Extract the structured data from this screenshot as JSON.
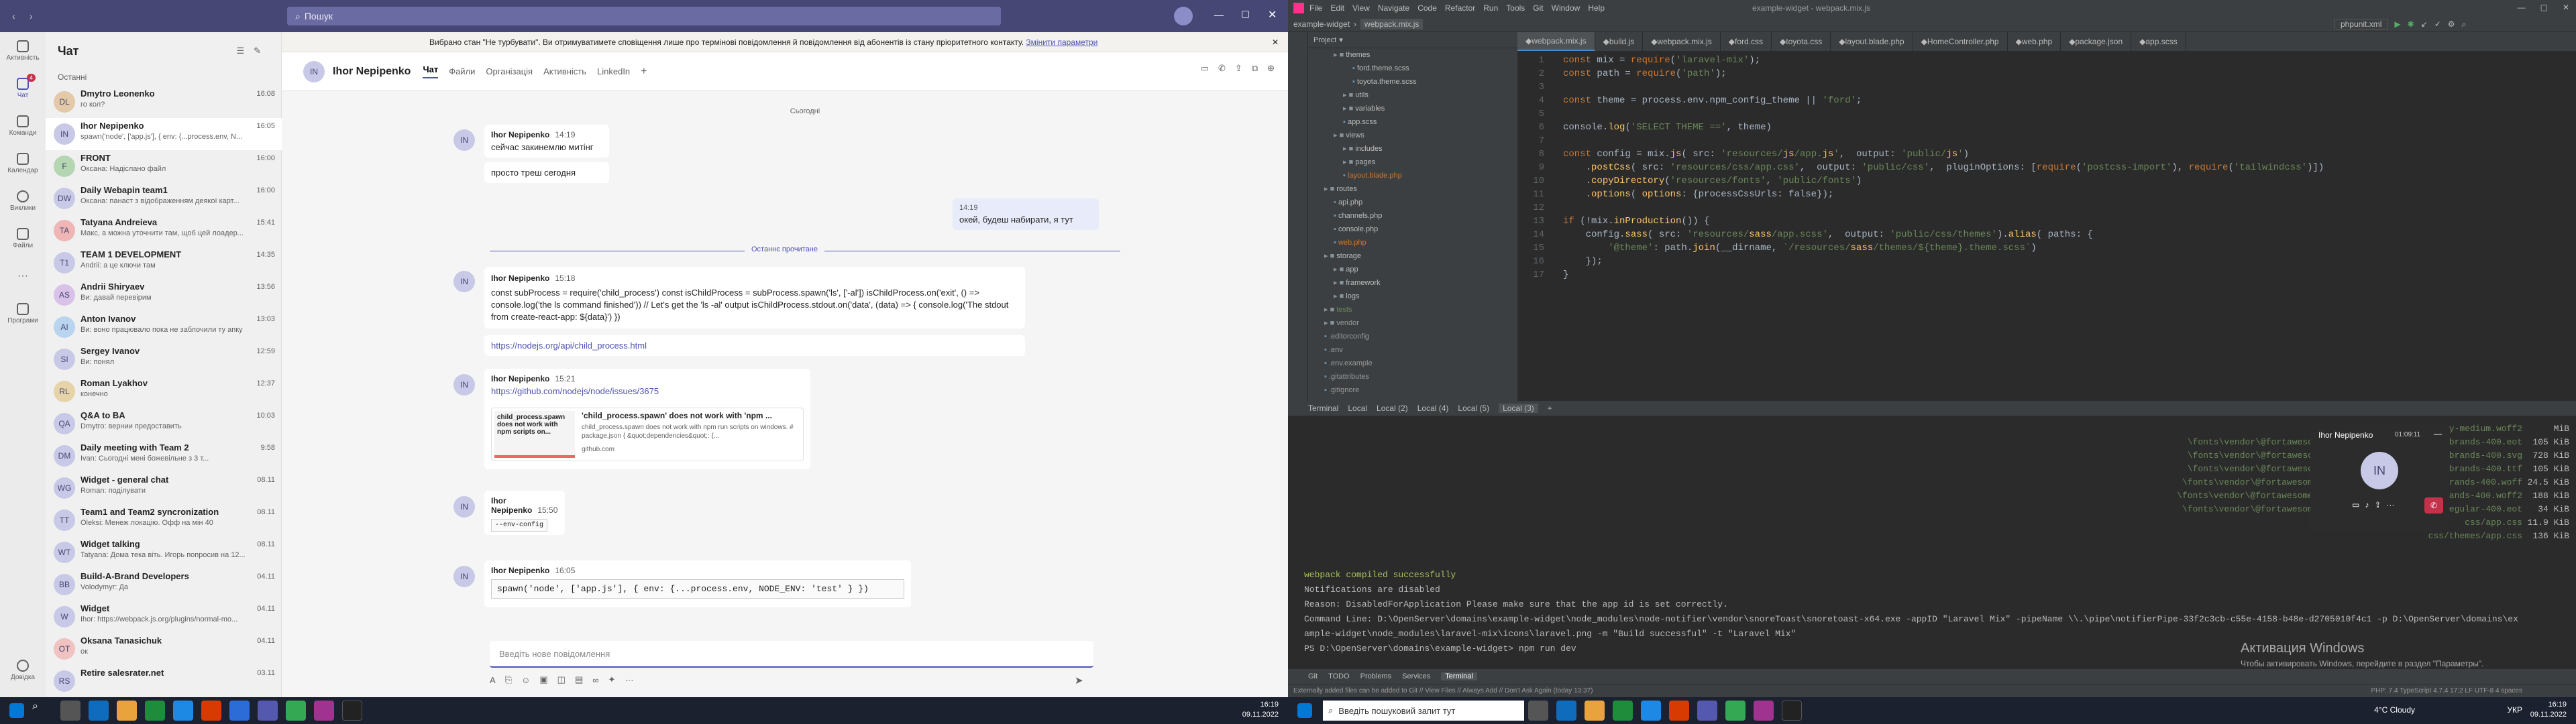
{
  "teams": {
    "search_placeholder": "Пошук",
    "rail": [
      "Активність",
      "Чат",
      "Команди",
      "Календар",
      "Виклики",
      "Файли",
      "Програми",
      "Довідка"
    ],
    "rail_badge": "4",
    "chat_header": "Чат",
    "recent_label": "Останні",
    "chats": [
      {
        "name": "Dmytro Leonenko",
        "preview": "го кол?",
        "time": "16:08",
        "initials": "DL"
      },
      {
        "name": "Ihor Nepipenko",
        "preview": "spawn('node', ['app.js'], { env: {...process.env, N...",
        "time": "16:05",
        "initials": "IN"
      },
      {
        "name": "FRONT",
        "preview": "Оксана: Надіслано файл",
        "time": "16:00",
        "initials": "F"
      },
      {
        "name": "Daily Webapin team1",
        "preview": "Оксана: панаст з відображенням деякої карт...",
        "time": "16:00",
        "initials": "DW"
      },
      {
        "name": "Tatyana Andreieva",
        "preview": "Макс, а можна уточнити там, щоб цей лоадер...",
        "time": "15:41",
        "initials": "TA"
      },
      {
        "name": "TEAM 1 DEVELOPMENT",
        "preview": "Andrii: а це ключи там",
        "time": "14:35",
        "initials": "T1"
      },
      {
        "name": "Andrii Shiryaev",
        "preview": "Ви: давай перевірим",
        "time": "13:56",
        "initials": "AS"
      },
      {
        "name": "Anton Ivanov",
        "preview": "Ви: воно працювало пока не заблочили ту апку",
        "time": "13:03",
        "initials": "AI"
      },
      {
        "name": "Sergey Ivanov",
        "preview": "Ви: понял",
        "time": "12:59",
        "initials": "SI"
      },
      {
        "name": "Roman Lyakhov",
        "preview": "конечно",
        "time": "12:37",
        "initials": "RL"
      },
      {
        "name": "Q&A to BA",
        "preview": "Dmytro: вернии предоставить",
        "time": "10:03",
        "initials": "QA"
      },
      {
        "name": "Daily meeting with Team 2",
        "preview": "Ivan: Сьогодні мені божевільне з 3 т...",
        "time": "9:58",
        "initials": "DM"
      },
      {
        "name": "Widget - general chat",
        "preview": "Roman: поділувати",
        "time": "08.11",
        "initials": "WG"
      },
      {
        "name": "Team1 and Team2 syncronization",
        "preview": "Oleksi: Менеж локацію. Офф на мін 40",
        "time": "08.11",
        "initials": "TT"
      },
      {
        "name": "Widget talking",
        "preview": "Tatyana: Дома тека віть. Игорь попросив на 12...",
        "time": "08.11",
        "initials": "WT"
      },
      {
        "name": "Build-A-Brand Developers",
        "preview": "Volodymyr: Да",
        "time": "04.11",
        "initials": "BB"
      },
      {
        "name": "Widget",
        "preview": "Ihor: https://webpack.js.org/plugins/normal-mo...",
        "time": "04.11",
        "initials": "W"
      },
      {
        "name": "Oksana Tanasichuk",
        "preview": "ок",
        "time": "04.11",
        "initials": "OT"
      },
      {
        "name": "Retire salesrater.net",
        "preview": "",
        "time": "03.11",
        "initials": "RS"
      }
    ],
    "banner": "Вибрано стан \"Не турбувати\". Ви отримуватимете сповіщення лише про термінові повідомлення й повідомлення від абонентів із стану пріоритетного контакту.",
    "banner_link": "Змінити параметри",
    "contact": {
      "name": "Ihor Nepipenko",
      "initials": "IN"
    },
    "tabs": [
      "Чат",
      "Файли",
      "Організація",
      "Активність",
      "LinkedIn",
      "+"
    ],
    "today_label": "Сьогодні",
    "read_label": "Останнє прочитане",
    "messages": {
      "m1": {
        "author": "Ihor Nepipenko",
        "time": "14:19",
        "l1": "сейчас закинемлю митінг",
        "l2": "просто треш сегодня"
      },
      "mine": {
        "time": "14:19",
        "text": "окей, будеш набирати, я тут"
      },
      "m2": {
        "author": "Ihor Nepipenko",
        "time": "15:18",
        "text": "const subProcess = require('child_process') const isChildProcess = subProcess.spawn('ls', ['-al']) isChildProcess.on('exit', () => console.log('the ls command finished')) // Let's get the 'ls -al' output isChildProcess.stdout.on('data', (data) => { console.log('The stdout from create-react-app: ${data}') })",
        "link": "https://nodejs.org/api/child_process.html"
      },
      "m3": {
        "author": "Ihor Nepipenko",
        "time": "15:21",
        "link": "https://github.com/nodejs/node/issues/3675",
        "card_title": "'child_process.spawn' does not work with 'npm ...",
        "card_text": "child_process.spawn does not work with npm run scripts on windows. # package.json { &quot;dependencies&quot;: {...",
        "card_host": "github.com",
        "thumb_title": "child_process.spawn does not work with npm scripts on..."
      },
      "m4": {
        "author": "Ihor Nepipenko",
        "time": "15:50",
        "text": "--env-config"
      },
      "m5": {
        "author": "Ihor Nepipenko",
        "time": "16:05",
        "code": "spawn('node', ['app.js'], { env: {...process.env, NODE_ENV: 'test' } })"
      }
    },
    "compose_placeholder": "Введіть нове повідомлення"
  },
  "taskbar_left": {
    "time": "16:19",
    "date": "09.11.2022",
    "search": "Введіть пошуковий запит тут"
  },
  "taskbar_right": {
    "time": "16:19",
    "date": "09.11.2022",
    "search": "Введіть пошуковий запит тут",
    "weather": "4°C Cloudy",
    "lang": "УКР"
  },
  "ide": {
    "menu": [
      "File",
      "Edit",
      "View",
      "Navigate",
      "Code",
      "Refactor",
      "Run",
      "Tools",
      "Git",
      "Window",
      "Help"
    ],
    "window_title": "example-widget - webpack.mix.js",
    "breadcrumb": "example-widget",
    "breadcrumb_file": "webpack.mix.js",
    "run_config": "phpunit.xml",
    "project_label": "Project",
    "tree": [
      "themes",
      "ford.theme.scss",
      "toyota.theme.scss",
      "utils",
      "variables",
      "app.scss",
      "views",
      "includes",
      "pages",
      "layout.blade.php",
      "routes",
      "api.php",
      "channels.php",
      "console.php",
      "web.php",
      "storage",
      "app",
      "framework",
      "logs",
      "tests",
      "vendor",
      ".editorconfig",
      ".env",
      ".env.example",
      ".gitattributes",
      ".gitignore"
    ],
    "tabs": [
      "webpack.mix.js",
      "build.js",
      "webpack.mix.js",
      "ford.css",
      "toyota.css",
      "layout.blade.php",
      "HomeController.php",
      "web.php",
      "package.json",
      "app.scss"
    ],
    "code": [
      "const mix = require('laravel-mix');",
      "const path = require('path');",
      "",
      "const theme = process.env.npm_config_theme || 'ford';",
      "",
      "console.log('SELECT THEME ==', theme)",
      "",
      "const config = mix.js( src: 'resources/js/app.js',  output: 'public/js')",
      "    .postCss( src: 'resources/css/app.css',  output: 'public/css',  pluginOptions: [require('postcss-import'), require('tailwindcss')])",
      "    .copyDirectory('resources/fonts', 'public/fonts')",
      "    .options( options: {processCssUrls: false});",
      "",
      "if (!mix.inProduction()) {",
      "    config.sass( src: 'resources/sass/app.scss',  output: 'public/css/themes').alias( paths: {",
      "        '@theme': path.join(__dirname, `/resources/sass/themes/${theme}.theme.scss`)",
      "    });",
      "}"
    ],
    "terminal_tabs": [
      "Terminal",
      "Local",
      "Local (2)",
      "Local (4)",
      "Local (5)",
      "Local (3)",
      "+"
    ],
    "terminal_top": [
      "\\fonts\\gilroy\\gilroy-medium.woff2",
      "\\fonts\\vendor\\@fortawesome\\fontawesome-free\\webfa-brands-400.eot",
      "\\fonts\\vendor\\@fortawesome\\fontawesome-free\\webfa-brands-400.svg",
      "\\fonts\\vendor\\@fortawesome\\fontawesome-free\\webfa-brands-400.ttf",
      "\\fonts\\vendor\\@fortawesome\\fontawesome-free\\webfa-brands-400.woff",
      "\\fonts\\vendor\\@fortawesome\\fontawesome-free\\webfa-brands-400.woff2",
      "\\fonts\\vendor\\@fortawesome\\fontawesome-free\\webfa-regular-400.eot",
      "css/app.css",
      "css/themes/app.css"
    ],
    "terminal_sizes": [
      "MiB",
      "105 KiB",
      "728 KiB",
      "105 KiB",
      "24.5 KiB",
      "188 KiB",
      "34 KiB",
      "11.9 KiB",
      "136 KiB"
    ],
    "terminal_lines": [
      "webpack compiled successfully",
      "Notifications are disabled",
      "Reason: DisabledForApplication Please make sure that the app id is set correctly.",
      "Command Line: D:\\OpenServer\\domains\\example-widget\\node_modules\\node-notifier\\vendor\\snoreToast\\snoretoast-x64.exe -appID \"Laravel Mix\" -pipeName \\\\.\\pipe\\notifierPipe-33f2c3cb-c55e-4158-b48e-d2705010f4c1 -p D:\\OpenServer\\domains\\ex",
      "ample-widget\\node_modules\\laravel-mix\\icons\\laravel.png -m \"Build successful\" -t \"Laravel Mix\"",
      "PS D:\\OpenServer\\domains\\example-widget> npm run dev"
    ],
    "activate_title": "Активация Windows",
    "activate_text": "Чтобы активировать Windows, перейдите в раздел \"Параметры\".",
    "bottom_tabs": [
      "Git",
      "TODO",
      "Problems",
      "Services",
      "Terminal"
    ],
    "status_left": "Externally added files can be added to Git // View Files // Always Add // Don't Ask Again (today 13:37)",
    "status_right": "PHP: 7.4   TypeScript 4.7.4   17:2   LF   UTF-8   4 spaces"
  },
  "call": {
    "name": "Ihor Nepipenko",
    "duration": "01:09:11",
    "initials": "IN"
  }
}
